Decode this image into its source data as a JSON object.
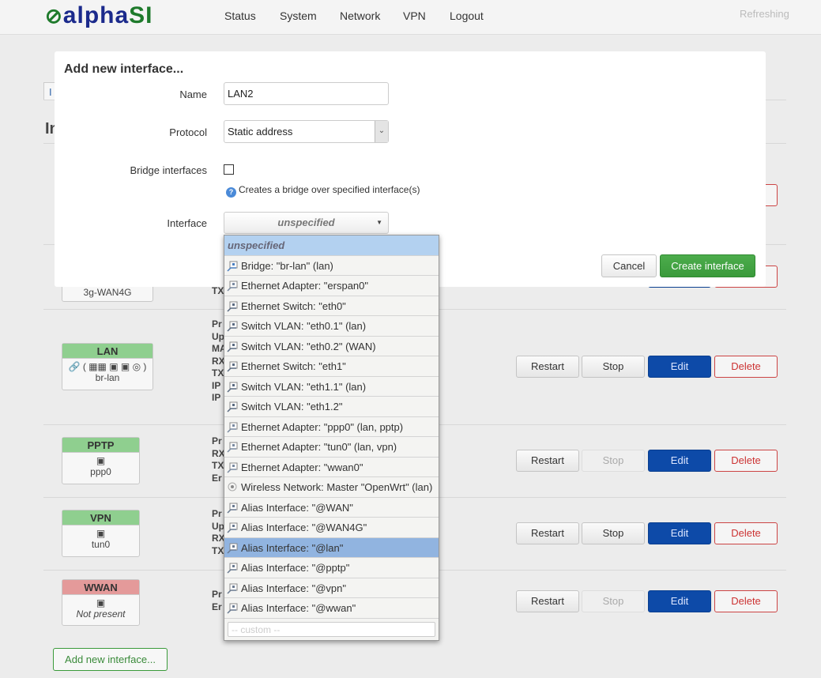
{
  "header": {
    "logo_text": "alpha",
    "logo_text2": "SI",
    "nav": [
      "Status",
      "System",
      "Network",
      "VPN",
      "Logout"
    ],
    "refresh": "Refreshing"
  },
  "page": {
    "tab_fragment": "I",
    "heading_fragment": "In"
  },
  "interfaces": [
    {
      "name": "3g-WAN4G",
      "label": "",
      "status": "up",
      "stat_fragments": [
        "TX"
      ]
    },
    {
      "name": "LAN",
      "device": "br-lan",
      "status": "up",
      "stat_fragments": [
        "Pr",
        "Up",
        "MA",
        "RX",
        "TX",
        "IP",
        "IP"
      ],
      "stop_enabled": true
    },
    {
      "name": "PPTP",
      "device": "ppp0",
      "status": "up",
      "stat_fragments": [
        "Pr",
        "RX",
        "TX",
        "Er"
      ],
      "stop_enabled": false
    },
    {
      "name": "VPN",
      "device": "tun0",
      "status": "up",
      "stat_fragments": [
        "Pr",
        "Up",
        "RX",
        "TX"
      ],
      "stop_enabled": true
    },
    {
      "name": "WWAN",
      "device": "Not present",
      "status": "down",
      "stat_fragments": [
        "Pr",
        "Er"
      ],
      "stop_enabled": false
    }
  ],
  "row_buttons": {
    "restart": "Restart",
    "stop": "Stop",
    "edit": "Edit",
    "delete": "Delete"
  },
  "add_button": "Add new interface...",
  "modal": {
    "title": "Add new interface...",
    "name_label": "Name",
    "name_value": "LAN2",
    "protocol_label": "Protocol",
    "protocol_value": "Static address",
    "bridge_label": "Bridge interfaces",
    "bridge_checked": false,
    "bridge_help": "Creates a bridge over specified interface(s)",
    "interface_label": "Interface",
    "interface_value": "unspecified",
    "cancel": "Cancel",
    "create": "Create interface"
  },
  "dropdown": {
    "options": [
      {
        "label": "unspecified",
        "icon": "none"
      },
      {
        "label": "Bridge: \"br-lan\" (lan)",
        "icon": "bridge-icon"
      },
      {
        "label": "Ethernet Adapter: \"erspan0\"",
        "icon": "ethernet-icon"
      },
      {
        "label": "Ethernet Switch: \"eth0\"",
        "icon": "switch-icon"
      },
      {
        "label": "Switch VLAN: \"eth0.1\" (lan)",
        "icon": "switch-icon"
      },
      {
        "label": "Switch VLAN: \"eth0.2\" (WAN)",
        "icon": "switch-icon"
      },
      {
        "label": "Ethernet Switch: \"eth1\"",
        "icon": "switch-icon"
      },
      {
        "label": "Switch VLAN: \"eth1.1\" (lan)",
        "icon": "switch-icon"
      },
      {
        "label": "Switch VLAN: \"eth1.2\"",
        "icon": "switch-icon"
      },
      {
        "label": "Ethernet Adapter: \"ppp0\" (lan, pptp)",
        "icon": "ethernet-icon"
      },
      {
        "label": "Ethernet Adapter: \"tun0\" (lan, vpn)",
        "icon": "ethernet-icon"
      },
      {
        "label": "Ethernet Adapter: \"wwan0\"",
        "icon": "ethernet-icon"
      },
      {
        "label": "Wireless Network: Master \"OpenWrt\" (lan)",
        "icon": "wifi-icon"
      },
      {
        "label": "Alias Interface: \"@WAN\"",
        "icon": "alias-icon"
      },
      {
        "label": "Alias Interface: \"@WAN4G\"",
        "icon": "alias-icon"
      },
      {
        "label": "Alias Interface: \"@lan\"",
        "icon": "alias-icon",
        "highlighted": true
      },
      {
        "label": "Alias Interface: \"@pptp\"",
        "icon": "alias-icon"
      },
      {
        "label": "Alias Interface: \"@vpn\"",
        "icon": "alias-icon"
      },
      {
        "label": "Alias Interface: \"@wwan\"",
        "icon": "alias-icon"
      }
    ],
    "custom_placeholder": "-- custom --"
  },
  "colors": {
    "create": "#3d9a3e",
    "edit": "#0d4aa8",
    "delete": "#cc3333",
    "highlight": "#91b4e0"
  }
}
